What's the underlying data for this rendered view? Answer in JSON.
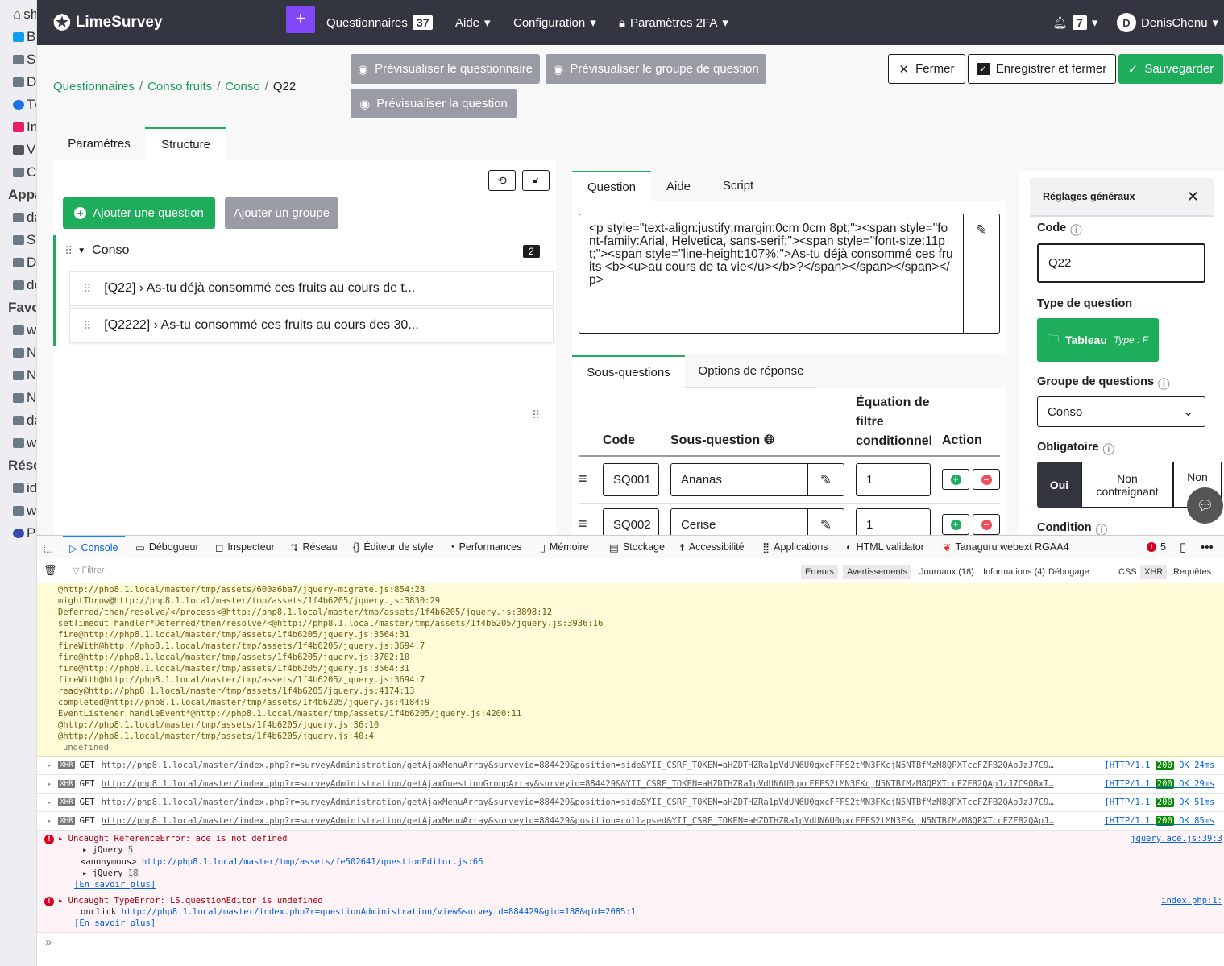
{
  "sidebar": {
    "items": [
      "sh",
      "B",
      "Sy",
      "D",
      "Té",
      "In",
      "Vi",
      "C"
    ],
    "headers": [
      "Appa",
      "Favo",
      "Rése"
    ],
    "apps": [
      "da",
      "ST",
      "D",
      "de"
    ],
    "favs": [
      "w",
      "N",
      "N",
      "N",
      "da",
      "w"
    ],
    "net": [
      "id",
      "w",
      "P"
    ]
  },
  "nav": {
    "brand": "LimeSurvey",
    "add": "+",
    "questionnaires": "Questionnaires",
    "q_count": "37",
    "aide": "Aide",
    "config": "Configuration",
    "twofa": "Paramètres 2FA",
    "notif_count": "7",
    "avatar": "D",
    "user": "DenisChenu"
  },
  "toolbar": {
    "preview_survey": "Prévisualiser le questionnaire",
    "preview_group": "Prévisualiser le groupe de question",
    "preview_question": "Prévisualiser la question",
    "close": "Fermer",
    "save_close": "Enregistrer et fermer",
    "save": "Sauvegarder"
  },
  "breadcrumb": [
    "Questionnaires",
    "Conso fruits",
    "Conso",
    "Q22"
  ],
  "left": {
    "tabs": [
      "Paramètres",
      "Structure"
    ],
    "add_question": "Ajouter une question",
    "add_group": "Ajouter un groupe",
    "group": "Conso",
    "group_count": "2",
    "questions": [
      "[Q22] › As-tu déjà consommé ces fruits au cours de t...",
      "[Q2222] › As-tu consommé ces fruits au cours des 30..."
    ]
  },
  "editor": {
    "tabs": [
      "Question",
      "Aide",
      "Script"
    ],
    "source": "<p style=\"text-align:justify;margin:0cm 0cm 8pt;\"><span style=\"font-family:Arial, Helvetica, sans-serif;\"><span style=\"font-size:11pt;\"><span style=\"line-height:107%;\">As-tu déjà consommé ces fruits <b><u>au cours de ta vie</u></b>?</span></span></span></p>",
    "subtabs": [
      "Sous-questions",
      "Options de réponse"
    ],
    "columns": [
      "Code",
      "Sous-question",
      "Équation de filtre conditionnel",
      "Action"
    ],
    "rows": [
      {
        "code": "SQ001",
        "text": "Ananas",
        "filter": "1"
      },
      {
        "code": "SQ002",
        "text": "Cerise",
        "filter": "1"
      }
    ]
  },
  "settings": {
    "title": "Réglages généraux",
    "code_label": "Code",
    "code": "Q22",
    "type_label": "Type de question",
    "type": "Tableau",
    "type_code": "Type : F",
    "group_label": "Groupe de questions",
    "group": "Conso",
    "mandatory_label": "Obligatoire",
    "mandatory_options": [
      "Oui",
      "Non contraignant",
      "Non"
    ],
    "condition_label": "Condition"
  },
  "devtools": {
    "tabs": [
      "Console",
      "Débogueur",
      "Inspecteur",
      "Réseau",
      "Éditeur de style",
      "Performances",
      "Mémoire",
      "Stockage",
      "Accessibilité",
      "Applications",
      "HTML validator",
      "Tanaguru webext RGAA4"
    ],
    "error_count": "5",
    "filter_placeholder": "Filtrer",
    "filters": [
      "Erreurs",
      "Avertissements",
      "Journaux (18)",
      "Informations (4)",
      "Débogage",
      "CSS",
      "XHR",
      "Requêtes"
    ],
    "stack": [
      "@http://php8.1.local/master/tmp/assets/600a6ba7/jquery-migrate.js:854:28",
      "mightThrow@http://php8.1.local/master/tmp/assets/1f4b6205/jquery.js:3830:29",
      "Deferred/then/resolve/</process<@http://php8.1.local/master/tmp/assets/1f4b6205/jquery.js:3898:12",
      "setTimeout handler*Deferred/then/resolve/<@http://php8.1.local/master/tmp/assets/1f4b6205/jquery.js:3936:16",
      "fire@http://php8.1.local/master/tmp/assets/1f4b6205/jquery.js:3564:31",
      "fireWith@http://php8.1.local/master/tmp/assets/1f4b6205/jquery.js:3694:7",
      "fire@http://php8.1.local/master/tmp/assets/1f4b6205/jquery.js:3702:10",
      "fire@http://php8.1.local/master/tmp/assets/1f4b6205/jquery.js:3564:31",
      "fireWith@http://php8.1.local/master/tmp/assets/1f4b6205/jquery.js:3694:7",
      "ready@http://php8.1.local/master/tmp/assets/1f4b6205/jquery.js:4174:13",
      "completed@http://php8.1.local/master/tmp/assets/1f4b6205/jquery.js:4184:9",
      "EventListener.handleEvent*@http://php8.1.local/master/tmp/assets/1f4b6205/jquery.js:4200:11",
      "@http://php8.1.local/master/tmp/assets/1f4b6205/jquery.js:36:10",
      "@http://php8.1.local/master/tmp/assets/1f4b6205/jquery.js:40:4"
    ],
    "undefined": "undefined",
    "xhr": [
      {
        "url": "http://php8.1.local/master/index.php?r=surveyAdministration/getAjaxMenuArray&surveyid=884429&position=side&YII_CSRF_TOKEN=aHZDTHZRa1pVdUN6U0gxcFFFS2tMN3FKcjN5NTBfMzM8QPXTccFZFB2QApJzJ7C9…",
        "time": "24ms"
      },
      {
        "url": "http://php8.1.local/master/index.php?r=surveyAdministration/getAjaxQuestionGroupArray&surveyid=884429&&YII_CSRF_TOKEN=aHZDTHZRa1pVdUN6U0gxcFFFS2tMN3FKcjN5NTBfMzM8QPXTccFZFB2QApJzJ7C9OBxT…",
        "time": "29ms"
      },
      {
        "url": "http://php8.1.local/master/index.php?r=surveyAdministration/getAjaxMenuArray&surveyid=884429&position=side&YII_CSRF_TOKEN=aHZDTHZRa1pVdUN6U0gxcFFFS2tMN3FKcjN5NTBfMzM8QPXTccFZFB2QApJzJ7C9…",
        "time": "51ms"
      },
      {
        "url": "http://php8.1.local/master/index.php?r=surveyAdministration/getAjaxMenuArray&surveyid=884429&position=collapsed&YII_CSRF_TOKEN=aHZDTHZRa1pVdUN6U0gxcFFFS2tMN3FKcjN5NTBfMzM8QPXTccFZFB2QApJ…",
        "time": "85ms"
      }
    ],
    "xhr_tag": "XHR",
    "method": "GET",
    "http": "[HTTP/1.1",
    "status": "200",
    "ok": "OK",
    "error1": {
      "msg": "Uncaught ReferenceError: ace is not defined",
      "src": "jquery.ace.js:39:3",
      "jq1": "jQuery",
      "jq1n": "5",
      "anon": "<anonymous>",
      "anon_url": "http://php8.1.local/master/tmp/assets/fe502641/questionEditor.js:66",
      "jq2": "jQuery",
      "jq2n": "18",
      "more": "[En savoir plus]"
    },
    "error2": {
      "msg": "Uncaught TypeError: LS.questionEditor is undefined",
      "src": "index.php:1:",
      "onclick": "onclick",
      "url": "http://php8.1.local/master/index.php?r=questionAdministration/view&surveyid=884429&gid=188&qid=2085:1",
      "more": "[En savoir plus]"
    },
    "prompt": "»"
  }
}
